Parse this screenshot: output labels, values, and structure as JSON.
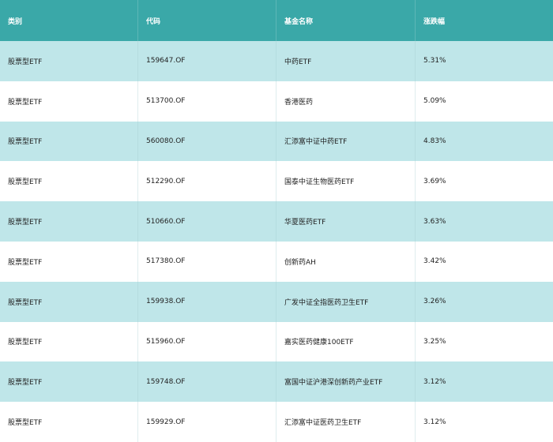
{
  "table": {
    "headers": [
      "类别",
      "代码",
      "基金名称",
      "涨跌幅"
    ],
    "rows": [
      [
        "股票型ETF",
        "159647.OF",
        "中药ETF",
        "5.31%"
      ],
      [
        "股票型ETF",
        "513700.OF",
        "香港医药",
        "5.09%"
      ],
      [
        "股票型ETF",
        "560080.OF",
        "汇添富中证中药ETF",
        "4.83%"
      ],
      [
        "股票型ETF",
        "512290.OF",
        "国泰中证生物医药ETF",
        "3.69%"
      ],
      [
        "股票型ETF",
        "510660.OF",
        "华夏医药ETF",
        "3.63%"
      ],
      [
        "股票型ETF",
        "517380.OF",
        "创新药AH",
        "3.42%"
      ],
      [
        "股票型ETF",
        "159938.OF",
        "广发中证全指医药卫生ETF",
        "3.26%"
      ],
      [
        "股票型ETF",
        "515960.OF",
        "嘉实医药健康100ETF",
        "3.25%"
      ],
      [
        "股票型ETF",
        "159748.OF",
        "富国中证沪港深创新药产业ETF",
        "3.12%"
      ],
      [
        "股票型ETF",
        "159929.OF",
        "汇添富中证医药卫生ETF",
        "3.12%"
      ]
    ]
  },
  "colors": {
    "header_bg": "#3aa8a8",
    "stripe_bg": "#bfe6e9",
    "row_bg": "#ffffff"
  }
}
